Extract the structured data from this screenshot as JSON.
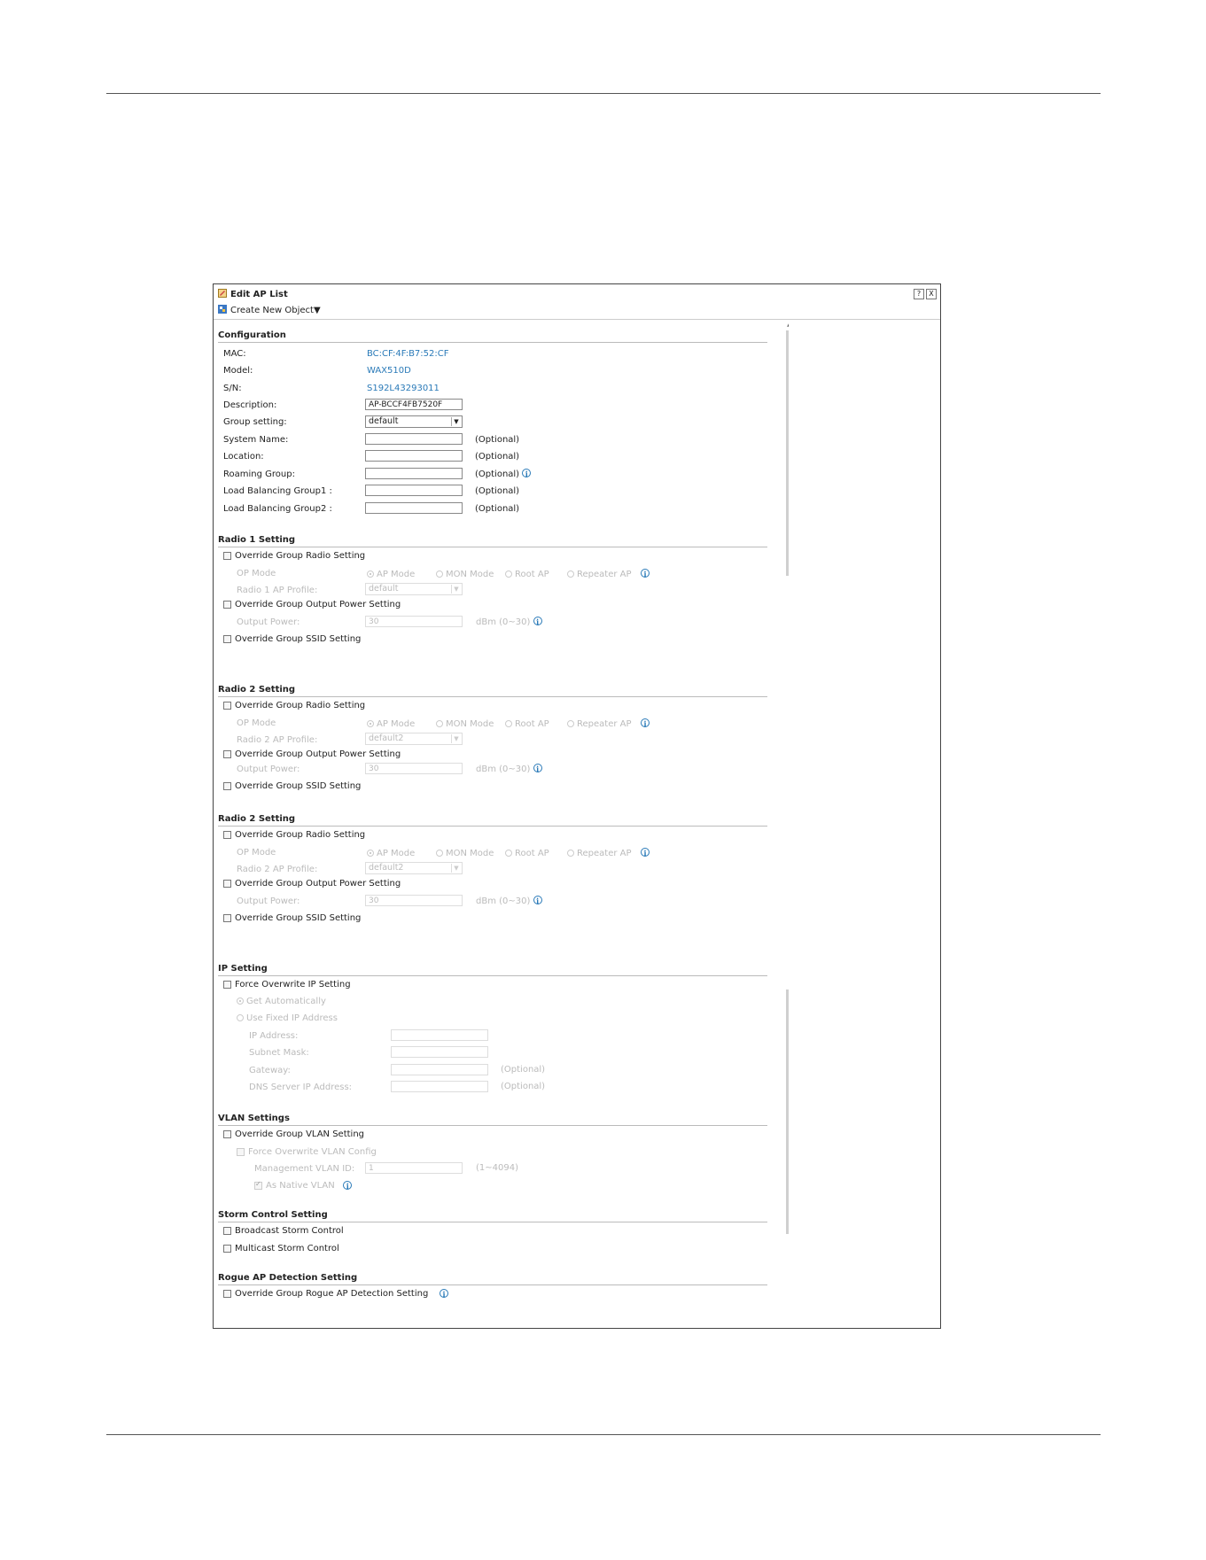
{
  "dialog": {
    "title": "Edit AP List",
    "help_icon": "?",
    "close_icon": "X",
    "create_new_object": "Create New Object▼"
  },
  "configuration": {
    "title": "Configuration",
    "mac_label": "MAC:",
    "mac_value": "BC:CF:4F:B7:52:CF",
    "model_label": "Model:",
    "model_value": "WAX510D",
    "sn_label": "S/N:",
    "sn_value": "S192L43293011",
    "description_label": "Description:",
    "description_value": "AP-BCCF4FB7520F",
    "group_setting_label": "Group setting:",
    "group_setting_value": "default",
    "system_name_label": "System Name:",
    "location_label": "Location:",
    "roaming_group_label": "Roaming Group:",
    "lb_group1_label": "Load Balancing Group1 :",
    "lb_group2_label": "Load Balancing Group2 :",
    "optional": "(Optional)"
  },
  "radio1": {
    "title": "Radio 1 Setting",
    "override_radio": "Override Group Radio Setting",
    "op_mode_label": "OP Mode",
    "modes": [
      "AP Mode",
      "MON Mode",
      "Root AP",
      "Repeater AP"
    ],
    "profile_label": "Radio 1 AP Profile:",
    "profile_value": "default",
    "override_output": "Override Group Output Power Setting",
    "output_power_label": "Output Power:",
    "output_power_value": "30",
    "output_unit": "dBm (0~30)",
    "override_ssid": "Override Group SSID Setting"
  },
  "radio2": {
    "title": "Radio 2 Setting",
    "override_radio": "Override Group Radio Setting",
    "op_mode_label": "OP Mode",
    "modes": [
      "AP Mode",
      "MON Mode",
      "Root AP",
      "Repeater AP"
    ],
    "profile_label": "Radio 2 AP Profile:",
    "profile_value": "default2",
    "override_output": "Override Group Output Power Setting",
    "output_power_label": "Output Power:",
    "output_power_value": "30",
    "output_unit": "dBm (0~30)",
    "override_ssid": "Override Group SSID Setting"
  },
  "ip": {
    "title": "IP Setting",
    "force_overwrite": "Force Overwrite IP Setting",
    "get_auto": "Get Automatically",
    "use_fixed": "Use Fixed IP Address",
    "ip_address": "IP Address:",
    "subnet_mask": "Subnet Mask:",
    "gateway": "Gateway:",
    "dns": "DNS Server IP Address:",
    "optional": "(Optional)"
  },
  "vlan": {
    "title": "VLAN Settings",
    "override": "Override Group VLAN Setting",
    "force_overwrite": "Force Overwrite VLAN Config",
    "mgmt_vlan_label": "Management VLAN ID:",
    "mgmt_vlan_value": "1",
    "range": "(1~4094)",
    "native": "As Native VLAN"
  },
  "storm": {
    "title": "Storm Control Setting",
    "broadcast": "Broadcast Storm Control",
    "multicast": "Multicast Storm Control"
  },
  "rogue": {
    "title": "Rogue AP Detection Setting",
    "override": "Override Group Rogue AP Detection Setting"
  },
  "info_glyph": "i"
}
